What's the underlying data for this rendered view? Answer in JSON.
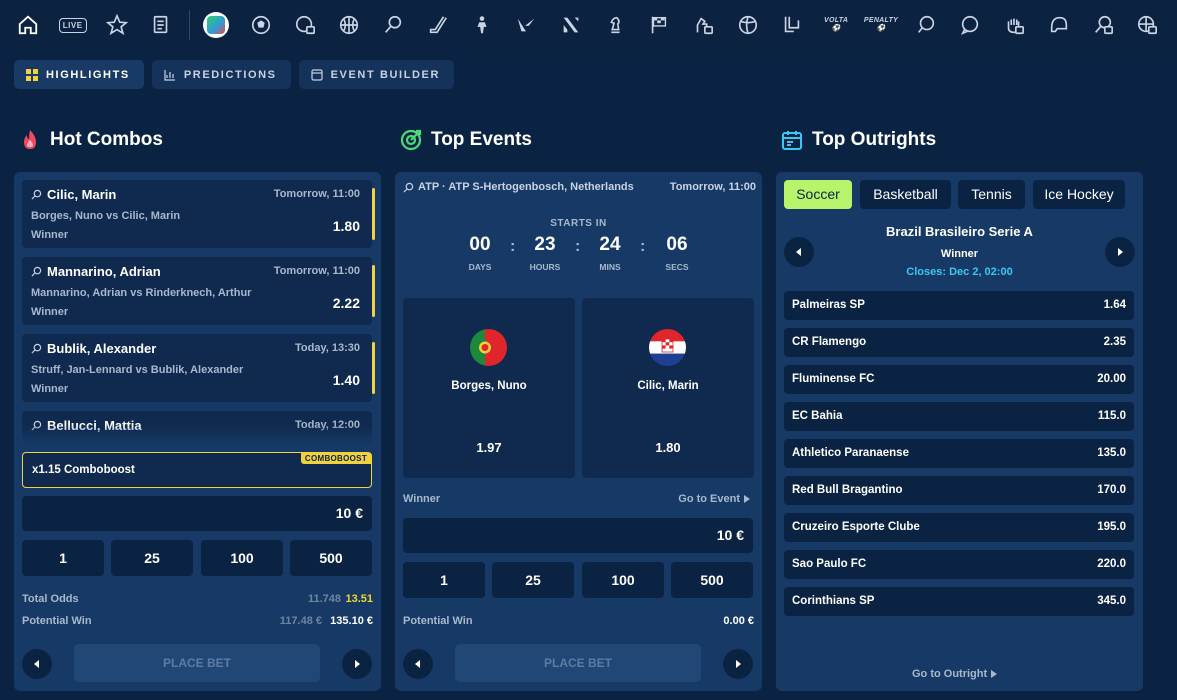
{
  "topnav": {
    "live_label": "LIVE",
    "volta_label": "VOLTA",
    "penalty_label": "PENALTY",
    "icons": [
      "home-icon",
      "live-icon",
      "star-icon",
      "betslip-icon",
      "worldcup-icon",
      "soccer-icon",
      "virtual-soccer-icon",
      "basketball-icon",
      "tennis-icon",
      "hockey-stick-icon",
      "esports-shooter-icon",
      "valorant-icon",
      "esports-icon",
      "chess-icon",
      "racing-flag-icon",
      "horse-racing-icon",
      "volleyball-icon",
      "league-icon",
      "volta-icon",
      "penalty-icon",
      "table-tennis-icon",
      "chat-icon",
      "fist-icon",
      "helmet-icon",
      "badminton-icon",
      "virtual-basketball-icon"
    ]
  },
  "subnav": {
    "tabs": [
      {
        "label": "HIGHLIGHTS",
        "icon": "grid-icon",
        "active": true
      },
      {
        "label": "PREDICTIONS",
        "icon": "chart-icon",
        "active": false
      },
      {
        "label": "EVENT BUILDER",
        "icon": "builder-icon",
        "active": false
      }
    ]
  },
  "hot_combos": {
    "title": "Hot Combos",
    "icon": "flame-icon",
    "items": [
      {
        "player": "Cilic, Marin",
        "time": "Tomorrow, 11:00",
        "match": "Borges, Nuno vs Cilic, Marin",
        "market": "Winner",
        "odds": "1.80"
      },
      {
        "player": "Mannarino, Adrian",
        "time": "Tomorrow, 11:00",
        "match": "Mannarino, Adrian vs Rinderknech, Arthur",
        "market": "Winner",
        "odds": "2.22"
      },
      {
        "player": "Bublik, Alexander",
        "time": "Today, 13:30",
        "match": "Struff, Jan-Lennard vs Bublik, Alexander",
        "market": "Winner",
        "odds": "1.40"
      },
      {
        "player": "Bellucci, Mattia",
        "time": "Today, 12:00",
        "match": "",
        "market": "",
        "odds": ""
      }
    ],
    "boost_label": "x1.15 Comboboost",
    "boost_tag": "COMBOBOOST",
    "stake_value": "10 €",
    "quick_stakes": [
      "1",
      "25",
      "100",
      "500"
    ],
    "total_odds_label": "Total Odds",
    "total_odds_old": "11.748",
    "total_odds_new": "13.51",
    "potential_win_label": "Potential Win",
    "potential_win_old": "117.48 €",
    "potential_win_new": "135.10 €",
    "place_bet_label": "PLACE BET"
  },
  "top_events": {
    "title": "Top Events",
    "icon": "target-icon",
    "event_header": "ATP · ATP S-Hertogenbosch, Netherlands",
    "event_time": "Tomorrow, 11:00",
    "starts_in_label": "STARTS IN",
    "countdown": [
      {
        "value": "00",
        "unit": "DAYS"
      },
      {
        "value": "23",
        "unit": "HOURS"
      },
      {
        "value": "24",
        "unit": "MINS"
      },
      {
        "value": "06",
        "unit": "SECS"
      }
    ],
    "teams": [
      {
        "name": "Borges, Nuno",
        "odds": "1.97",
        "flag": "portugal-flag"
      },
      {
        "name": "Cilic, Marin",
        "odds": "1.80",
        "flag": "croatia-flag"
      }
    ],
    "market_label": "Winner",
    "go_to_event_label": "Go to Event",
    "stake_value": "10 €",
    "quick_stakes": [
      "1",
      "25",
      "100",
      "500"
    ],
    "potential_win_label": "Potential Win",
    "potential_win_value": "0.00 €",
    "place_bet_label": "PLACE BET"
  },
  "top_outrights": {
    "title": "Top Outrights",
    "icon": "calendar-icon",
    "sport_tabs": [
      {
        "label": "Soccer",
        "active": true
      },
      {
        "label": "Basketball",
        "active": false
      },
      {
        "label": "Tennis",
        "active": false
      },
      {
        "label": "Ice Hockey",
        "active": false
      }
    ],
    "competition": "Brazil Brasileiro Serie A",
    "market": "Winner",
    "closes": "Closes: Dec 2, 02:00",
    "rows": [
      {
        "team": "Palmeiras SP",
        "odds": "1.64"
      },
      {
        "team": "CR Flamengo",
        "odds": "2.35"
      },
      {
        "team": "Fluminense FC",
        "odds": "20.00"
      },
      {
        "team": "EC Bahia",
        "odds": "115.0"
      },
      {
        "team": "Athletico Paranaense",
        "odds": "135.0"
      },
      {
        "team": "Red Bull Bragantino",
        "odds": "170.0"
      },
      {
        "team": "Cruzeiro Esporte Clube",
        "odds": "195.0"
      },
      {
        "team": "Sao Paulo FC",
        "odds": "220.0"
      },
      {
        "team": "Corinthians SP",
        "odds": "345.0"
      }
    ],
    "go_to_outright_label": "Go to Outright"
  },
  "colors": {
    "background": "#0b2343",
    "panel": "#163a65",
    "accent_yellow": "#f1d23b",
    "accent_green": "#b7f46b",
    "accent_cyan": "#3cc6f3"
  }
}
